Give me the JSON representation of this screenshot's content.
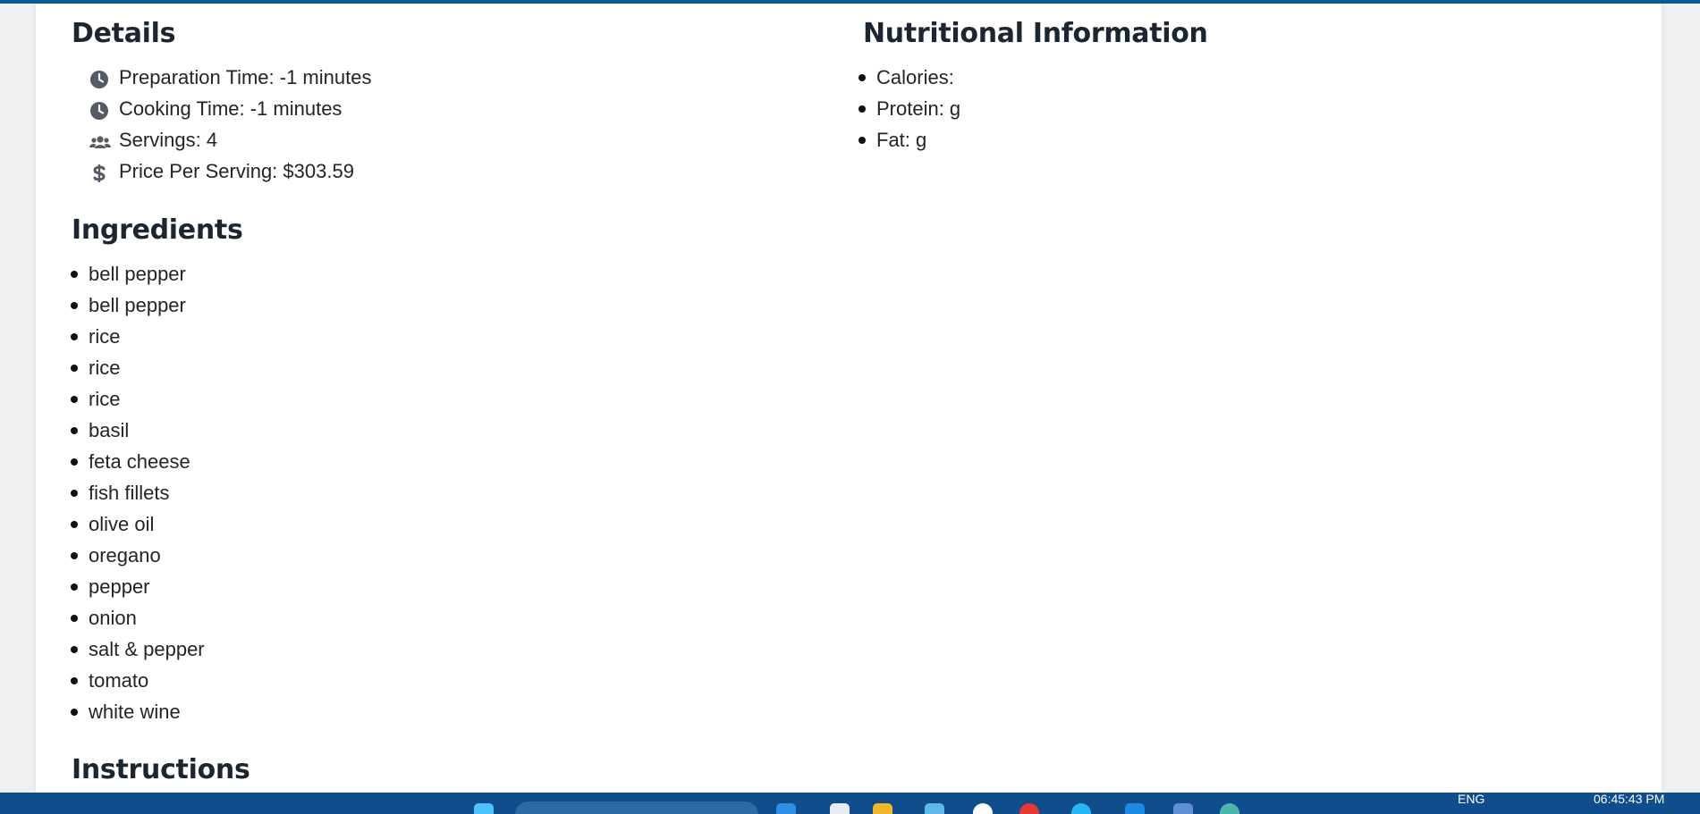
{
  "details": {
    "heading": "Details",
    "items": [
      {
        "icon": "clock-icon",
        "label": "Preparation Time: -1 minutes"
      },
      {
        "icon": "clock-icon",
        "label": "Cooking Time: -1 minutes"
      },
      {
        "icon": "users-icon",
        "label": "Servings: 4"
      },
      {
        "icon": "dollar-icon",
        "label": "Price Per Serving: $303.59"
      }
    ]
  },
  "nutrition": {
    "heading": "Nutritional Information",
    "items": [
      "Calories:",
      "Protein: g",
      "Fat: g"
    ]
  },
  "ingredients": {
    "heading": "Ingredients",
    "items": [
      "bell pepper",
      "bell pepper",
      "rice",
      "rice",
      "rice",
      "basil",
      "feta cheese",
      "fish fillets",
      "olive oil",
      "oregano",
      "pepper",
      "onion",
      "salt & pepper",
      "tomato",
      "white wine"
    ]
  },
  "instructions": {
    "heading": "Instructions"
  },
  "taskbar": {
    "language": "ENG",
    "time": "06:45:43 PM"
  },
  "colors": {
    "accent": "#0b5a95",
    "taskbar": "#0f4d8c",
    "background": "#eef0f2",
    "icon": "#555b66"
  }
}
